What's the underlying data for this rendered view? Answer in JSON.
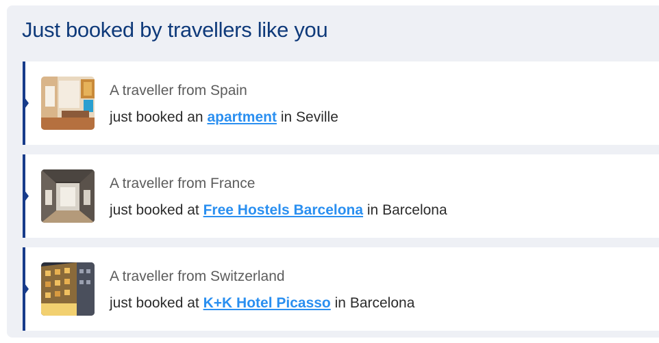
{
  "widget": {
    "title": "Just booked by travellers like you",
    "accent_color": "#173b8a",
    "link_color": "#2a8ff0",
    "items": [
      {
        "origin": "A traveller from Spain",
        "prefix": "just booked an",
        "link": "apartment",
        "location_prefix": "in",
        "location": "Seville",
        "thumbnail": "apartment-interior-photo"
      },
      {
        "origin": "A traveller from France",
        "prefix": "just booked at",
        "link": "Free Hostels Barcelona",
        "location_prefix": "in",
        "location": "Barcelona",
        "thumbnail": "hostel-corridor-photo"
      },
      {
        "origin": "A traveller from Switzerland",
        "prefix": "just booked at",
        "link": "K+K Hotel Picasso",
        "location_prefix": "in",
        "location": "Barcelona",
        "thumbnail": "hotel-facade-photo"
      }
    ]
  }
}
